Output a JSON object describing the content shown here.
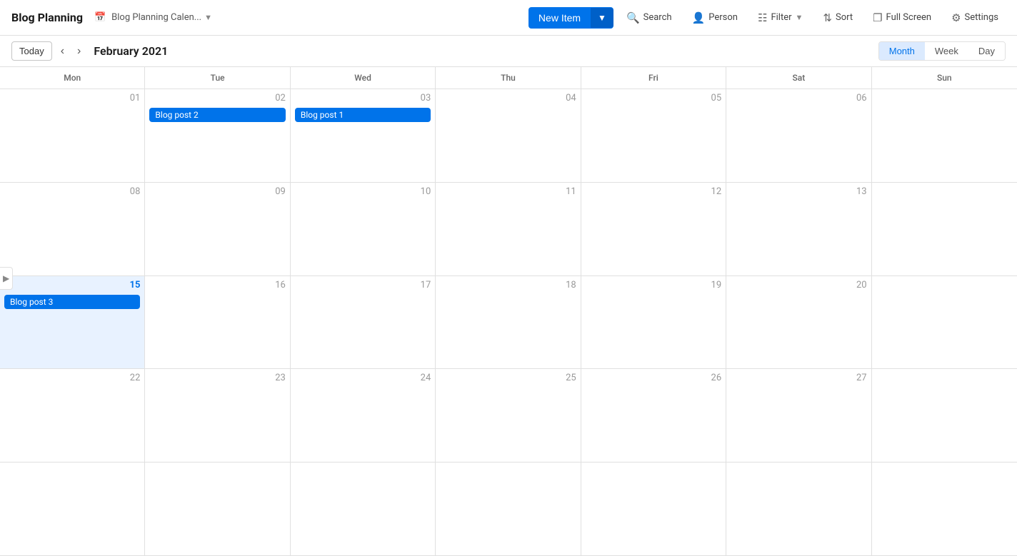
{
  "header": {
    "title": "Blog Planning",
    "board_label": "Blog Planning Calen...",
    "new_item_label": "New Item",
    "search_label": "Search",
    "person_label": "Person",
    "filter_label": "Filter",
    "sort_label": "Sort",
    "fullscreen_label": "Full Screen",
    "settings_label": "Settings"
  },
  "toolbar": {
    "today_label": "Today",
    "current_month": "February 2021",
    "views": [
      {
        "id": "month",
        "label": "Month",
        "active": true
      },
      {
        "id": "week",
        "label": "Week",
        "active": false
      },
      {
        "id": "day",
        "label": "Day",
        "active": false
      }
    ]
  },
  "calendar": {
    "day_headers": [
      "Mon",
      "Tue",
      "Wed",
      "Thu",
      "Fri",
      "Sat",
      "Sun"
    ],
    "weeks": [
      [
        {
          "date": "01",
          "highlight": false,
          "events": []
        },
        {
          "date": "02",
          "highlight": false,
          "events": [
            "Blog post 2"
          ]
        },
        {
          "date": "03",
          "highlight": false,
          "events": [
            "Blog post 1"
          ]
        },
        {
          "date": "04",
          "highlight": false,
          "events": []
        },
        {
          "date": "05",
          "highlight": false,
          "events": []
        },
        {
          "date": "06",
          "highlight": false,
          "events": []
        },
        {
          "date": "",
          "highlight": false,
          "events": []
        }
      ],
      [
        {
          "date": "08",
          "highlight": false,
          "events": []
        },
        {
          "date": "09",
          "highlight": false,
          "events": []
        },
        {
          "date": "10",
          "highlight": false,
          "events": []
        },
        {
          "date": "11",
          "highlight": false,
          "events": []
        },
        {
          "date": "12",
          "highlight": false,
          "events": []
        },
        {
          "date": "13",
          "highlight": false,
          "events": []
        },
        {
          "date": "",
          "highlight": false,
          "events": []
        }
      ],
      [
        {
          "date": "15",
          "highlight": true,
          "today": true,
          "events": [
            "Blog post 3"
          ]
        },
        {
          "date": "16",
          "highlight": false,
          "events": []
        },
        {
          "date": "17",
          "highlight": false,
          "events": []
        },
        {
          "date": "18",
          "highlight": false,
          "events": []
        },
        {
          "date": "19",
          "highlight": false,
          "events": []
        },
        {
          "date": "20",
          "highlight": false,
          "events": []
        },
        {
          "date": "",
          "highlight": false,
          "events": []
        }
      ],
      [
        {
          "date": "22",
          "highlight": false,
          "events": []
        },
        {
          "date": "23",
          "highlight": false,
          "events": []
        },
        {
          "date": "24",
          "highlight": false,
          "events": []
        },
        {
          "date": "25",
          "highlight": false,
          "events": []
        },
        {
          "date": "26",
          "highlight": false,
          "events": []
        },
        {
          "date": "27",
          "highlight": false,
          "events": []
        },
        {
          "date": "",
          "highlight": false,
          "events": []
        }
      ],
      [
        {
          "date": "",
          "highlight": false,
          "events": []
        },
        {
          "date": "",
          "highlight": false,
          "events": []
        },
        {
          "date": "",
          "highlight": false,
          "events": []
        },
        {
          "date": "",
          "highlight": false,
          "events": []
        },
        {
          "date": "",
          "highlight": false,
          "events": []
        },
        {
          "date": "",
          "highlight": false,
          "events": []
        },
        {
          "date": "",
          "highlight": false,
          "events": []
        }
      ]
    ]
  },
  "colors": {
    "accent": "#0073ea",
    "event_bg": "#0073ea",
    "today_highlight": "#e8f2ff",
    "today_text": "#0073ea"
  }
}
